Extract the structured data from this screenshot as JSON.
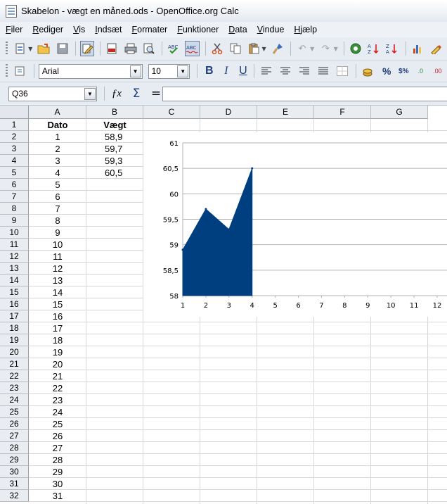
{
  "window": {
    "title": "Skabelon - vægt en måned.ods - OpenOffice.org Calc"
  },
  "menu": [
    "Filer",
    "Rediger",
    "Vis",
    "Indsæt",
    "Formater",
    "Funktioner",
    "Data",
    "Vindue",
    "Hjælp"
  ],
  "toolbar1": {
    "icons": [
      "new-document-icon",
      "open-folder-icon",
      "save-icon",
      "edit-document-icon",
      "export-pdf-icon",
      "print-icon",
      "print-preview-icon",
      "spellcheck-icon",
      "autospellcheck-icon",
      "cut-icon",
      "copy-icon",
      "paste-icon",
      "format-paintbrush-icon",
      "undo-icon",
      "redo-icon",
      "navigator-icon",
      "sort-ascending-icon",
      "sort-descending-icon",
      "chart-icon",
      "draw-functions-icon"
    ]
  },
  "toolbar2": {
    "font_name": "Arial",
    "font_size": "10",
    "bold_label": "B",
    "italic_label": "I",
    "underline_label": "U",
    "percent_label": "%",
    "currency_label": "$%",
    "add_decimal_label": ".0",
    "remove_decimal_label": ".00"
  },
  "formula_bar": {
    "cell_reference": "Q36",
    "content": ""
  },
  "sheet": {
    "columns": [
      "A",
      "B",
      "C",
      "D",
      "E",
      "F",
      "G"
    ],
    "rows": [
      "1",
      "2",
      "3",
      "4",
      "5",
      "6",
      "7",
      "8",
      "9",
      "10",
      "11",
      "12",
      "13",
      "14",
      "15",
      "16",
      "17",
      "18",
      "19",
      "20",
      "21",
      "22",
      "23",
      "24",
      "25",
      "26",
      "27",
      "28",
      "29",
      "30",
      "31",
      "32"
    ],
    "headers": {
      "A": "Dato",
      "B": "Vægt"
    },
    "col_a": [
      "1",
      "2",
      "3",
      "4",
      "5",
      "6",
      "7",
      "8",
      "9",
      "10",
      "11",
      "12",
      "13",
      "14",
      "15",
      "16",
      "17",
      "18",
      "19",
      "20",
      "21",
      "22",
      "23",
      "24",
      "25",
      "26",
      "27",
      "28",
      "29",
      "30",
      "31"
    ],
    "col_b": [
      "58,9",
      "59,7",
      "59,3",
      "60,5"
    ]
  },
  "chart_data": {
    "type": "area",
    "x": [
      1,
      2,
      3,
      4
    ],
    "values": [
      58.9,
      59.7,
      59.3,
      60.5
    ],
    "xticks": [
      "1",
      "2",
      "3",
      "4",
      "5",
      "6",
      "7",
      "8",
      "9",
      "10",
      "11",
      "12"
    ],
    "yticks": [
      "58",
      "58,5",
      "59",
      "59,5",
      "60",
      "60,5",
      "61"
    ],
    "ylim": [
      58,
      61
    ],
    "xlim": [
      1,
      12
    ],
    "grid": "horizontal",
    "color": "#003f7f"
  }
}
